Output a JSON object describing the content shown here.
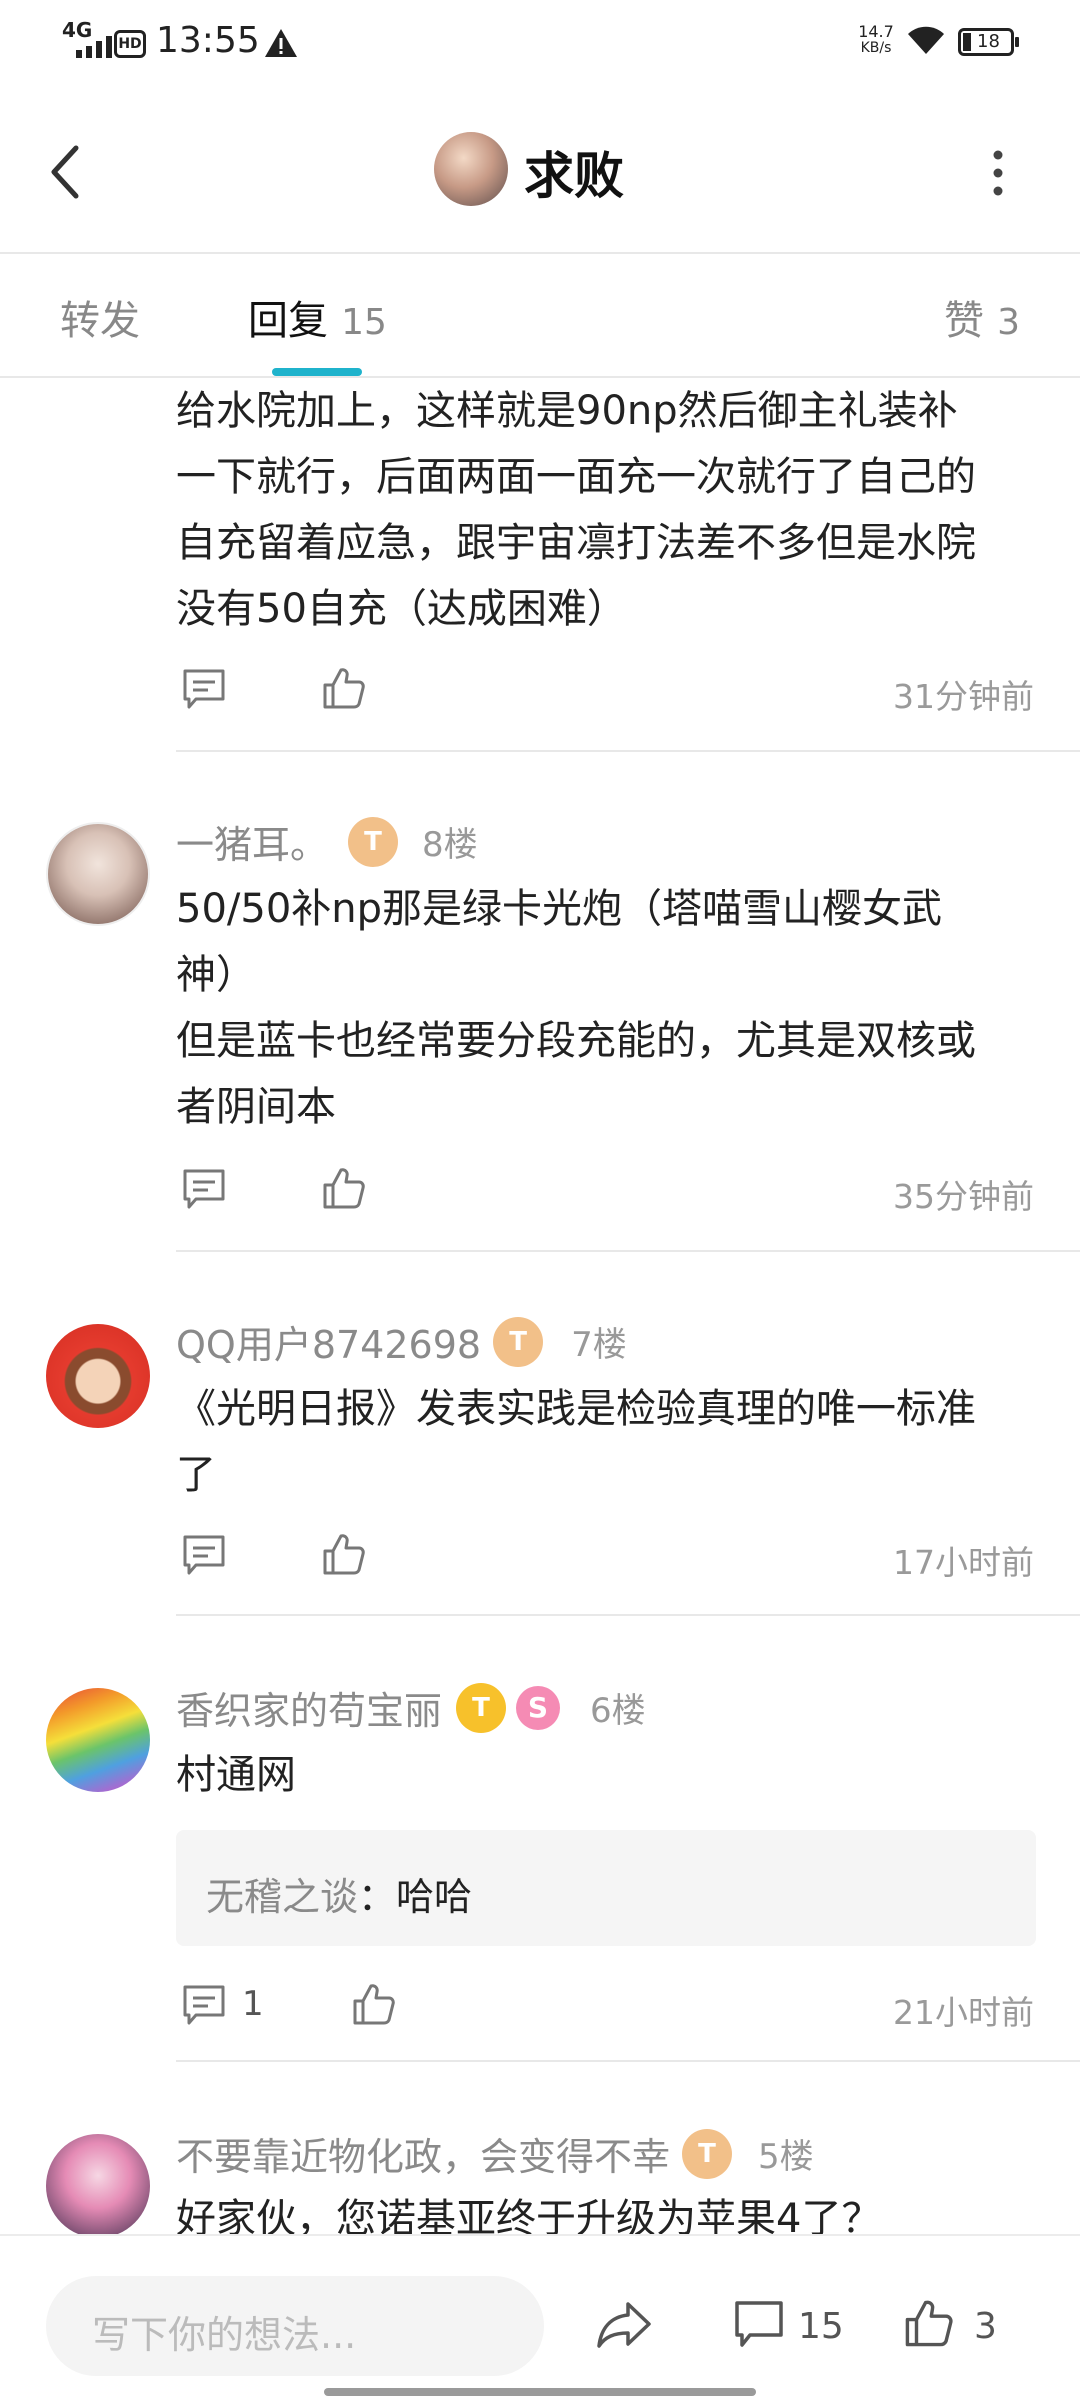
{
  "status_bar": {
    "network": "4G",
    "hd": "HD",
    "time": "13:55",
    "speed_value": "14.7",
    "speed_unit": "KB/s",
    "battery": "18"
  },
  "header": {
    "title": "求败"
  },
  "tabs": [
    {
      "label": "转发",
      "count": ""
    },
    {
      "label": "回复",
      "count": "15"
    },
    {
      "label": "赞",
      "count": "3"
    }
  ],
  "comments": [
    {
      "lines": [
        "给水院加上，这样就是90np然后御主礼装补",
        "一下就行，后面两面一面充一次就行了自己的",
        "自充留着应急，跟宇宙凛打法差不多但是水院",
        "没有50自充（达成困难）"
      ],
      "time": "31分钟前"
    },
    {
      "name": "一猪耳。",
      "badge": "T",
      "floor": "8楼",
      "lines": [
        "50/50补np那是绿卡光炮（塔喵雪山樱女武",
        "神）",
        "但是蓝卡也经常要分段充能的，尤其是双核或",
        "者阴间本"
      ],
      "time": "35分钟前"
    },
    {
      "name": "QQ用户8742698",
      "badge": "T",
      "floor": "7楼",
      "lines": [
        "《光明日报》发表实践是检验真理的唯一标准",
        "了"
      ],
      "time": "17小时前"
    },
    {
      "name": "香织家的苟宝丽",
      "badge": "T",
      "badge2": "S",
      "floor": "6楼",
      "lines": [
        "村通网"
      ],
      "quote": {
        "name": "无稽之谈",
        "sep": "：",
        "text": "哈哈"
      },
      "reply_count": "1",
      "time": "21小时前"
    },
    {
      "name": "不要靠近物化政，会变得不幸",
      "badge": "T",
      "floor": "5楼",
      "lines": [
        "好家伙，您诺基亚终于升级为苹果4了？"
      ]
    }
  ],
  "bottom_bar": {
    "placeholder": "写下你的想法...",
    "comment_count": "15",
    "like_count": "3"
  },
  "colors": {
    "accent": "#1fb3cc",
    "text": "#222222",
    "muted": "#8a8a8a"
  }
}
